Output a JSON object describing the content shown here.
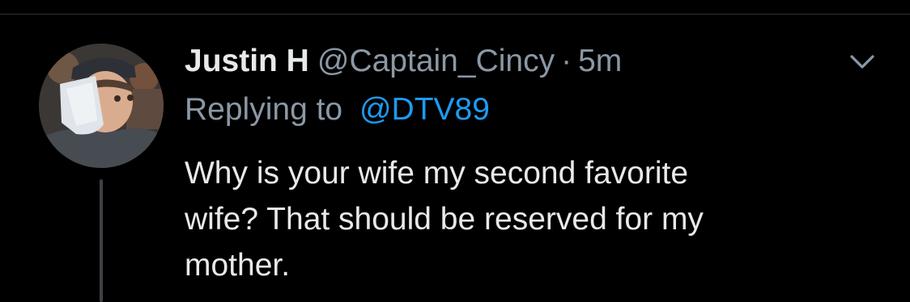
{
  "tweet": {
    "display_name": "Justin H",
    "handle": "@Captain_Cincy",
    "separator": "·",
    "time": "5m",
    "replying_prefix": "Replying to",
    "replying_to": "@DTV89",
    "text": "Why is your wife my second favorite\nwife? That should be reserved for my\nmother."
  },
  "icons": {
    "avatar": "user-photo-avatar",
    "menu": "chevron-down-icon"
  },
  "colors": {
    "background": "#000000",
    "primary_text": "#e7e9ea",
    "secondary_text": "#8b98a5",
    "link": "#1d9bf0",
    "thread_line": "#3d4145"
  }
}
